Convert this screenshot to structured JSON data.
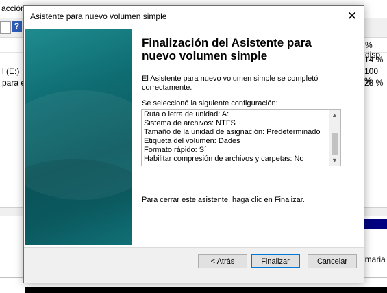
{
  "background_window": {
    "menu_text": "acción",
    "help_icon_text": "?",
    "column_header": "% disp",
    "rows": [
      {
        "left": "",
        "right": "14 %"
      },
      {
        "left": "l (E:)",
        "right": "100 %"
      },
      {
        "left": "para e",
        "right": "28 %"
      }
    ],
    "lower_text": "imaria"
  },
  "dialog": {
    "title": "Asistente para nuevo volumen simple",
    "close_glyph": "✕",
    "heading": "Finalización del Asistente para nuevo volumen simple",
    "message": "El Asistente para nuevo volumen simple se completó correctamente.",
    "config_label": "Se seleccionó la siguiente configuración:",
    "config_lines": [
      "Ruta o letra de unidad: A:",
      "Sistema de archivos: NTFS",
      "Tamaño de la unidad de asignación: Predeterminado",
      "Etiqueta del volumen: Dades",
      "Formato rápido: Sí",
      "Habilitar compresión de archivos y carpetas: No"
    ],
    "finish_note": "Para cerrar este asistente, haga clic en Finalizar.",
    "buttons": {
      "back": "< Atrás",
      "finish": "Finalizar",
      "cancel": "Cancelar"
    }
  },
  "colors": {
    "sidebar_teal": "#0f6e73",
    "accent_focus": "#0078d7"
  },
  "icons": {
    "close": "close-icon",
    "scroll_up": "chevron-up-icon",
    "scroll_down": "chevron-down-icon",
    "help": "help-icon"
  }
}
